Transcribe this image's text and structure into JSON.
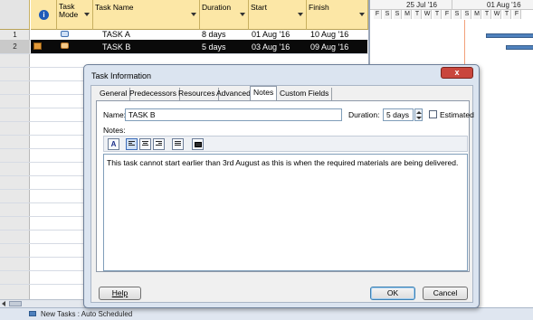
{
  "table": {
    "columns": {
      "info": "i",
      "task_mode": "Task Mode",
      "task_name": "Task Name",
      "duration": "Duration",
      "start": "Start",
      "finish": "Finish"
    },
    "rows": [
      {
        "num": "1",
        "name": "TASK A",
        "duration": "8 days",
        "start": "01 Aug '16",
        "finish": "10 Aug '16"
      },
      {
        "num": "2",
        "name": "TASK B",
        "duration": "5 days",
        "start": "03 Aug '16",
        "finish": "09 Aug '16"
      }
    ]
  },
  "gantt": {
    "weeks": [
      "25 Jul '16",
      "01 Aug '16"
    ],
    "days": [
      "F",
      "S",
      "S",
      "M",
      "T",
      "W",
      "T",
      "F",
      "S",
      "S",
      "M",
      "T",
      "W",
      "T",
      "F"
    ]
  },
  "dialog": {
    "title": "Task Information",
    "close": "x",
    "tabs": [
      "General",
      "Predecessors",
      "Resources",
      "Advanced",
      "Notes",
      "Custom Fields"
    ],
    "active_tab": "Notes",
    "name_label": "Name:",
    "name_value": "TASK B",
    "duration_label": "Duration:",
    "duration_value": "5 days",
    "estimated_label": "Estimated",
    "estimated_checked": false,
    "notes_label": "Notes:",
    "notes_text": "This task cannot start earlier than 3rd August as this is when the required materials are being delivered.",
    "help_button": "Help",
    "ok_button": "OK",
    "cancel_button": "Cancel"
  },
  "statusbar": {
    "new_tasks": "New Tasks : Auto Scheduled"
  },
  "colors": {
    "header_bg": "#fce7a6",
    "selected_row_bg": "#0a0a0a",
    "gantt_bar": "#4f81bd",
    "dialog_bg": "#dbe4f0",
    "close_button": "#c9463d"
  }
}
